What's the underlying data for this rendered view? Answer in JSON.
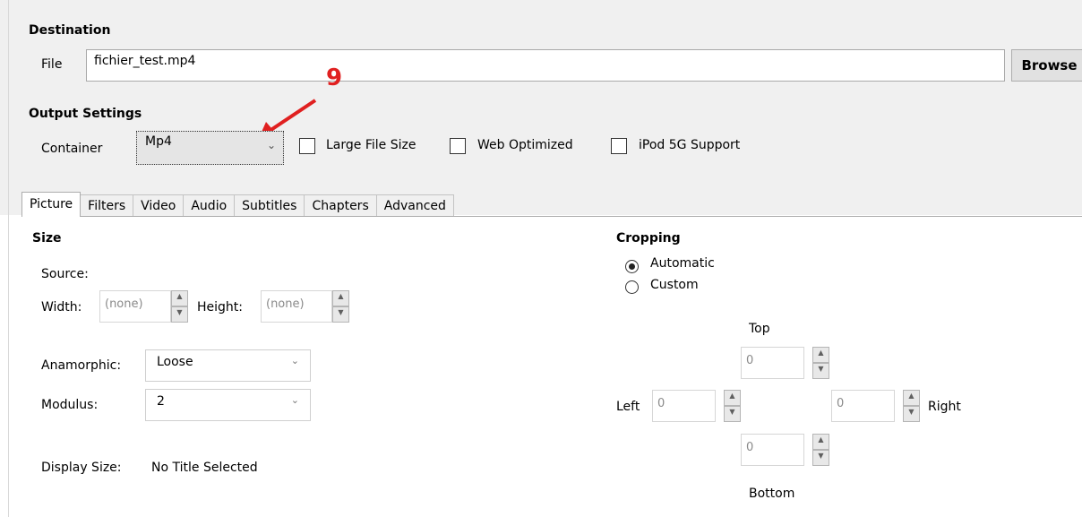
{
  "destination": {
    "heading": "Destination",
    "file_label": "File",
    "file_value": "fichier_test.mp4",
    "browse_label": "Browse"
  },
  "annotation": {
    "number": "9",
    "color": "#e02020"
  },
  "output_settings": {
    "heading": "Output Settings",
    "container_label": "Container",
    "container_value": "Mp4",
    "options": [
      {
        "label": "Large File Size",
        "checked": false
      },
      {
        "label": "Web Optimized",
        "checked": false
      },
      {
        "label": "iPod 5G Support",
        "checked": false
      }
    ]
  },
  "tabs": [
    "Picture",
    "Filters",
    "Video",
    "Audio",
    "Subtitles",
    "Chapters",
    "Advanced"
  ],
  "active_tab": "Picture",
  "size": {
    "heading": "Size",
    "source_label": "Source:",
    "width_label": "Width:",
    "width_value": "(none)",
    "height_label": "Height:",
    "height_value": "(none)",
    "anamorphic_label": "Anamorphic:",
    "anamorphic_value": "Loose",
    "modulus_label": "Modulus:",
    "modulus_value": "2",
    "display_size_label": "Display Size:",
    "display_size_value": "No Title Selected"
  },
  "cropping": {
    "heading": "Cropping",
    "automatic_label": "Automatic",
    "custom_label": "Custom",
    "selected": "Automatic",
    "top_label": "Top",
    "top_value": "0",
    "left_label": "Left",
    "left_value": "0",
    "right_label": "Right",
    "right_value": "0",
    "bottom_label": "Bottom",
    "bottom_value": "0"
  }
}
